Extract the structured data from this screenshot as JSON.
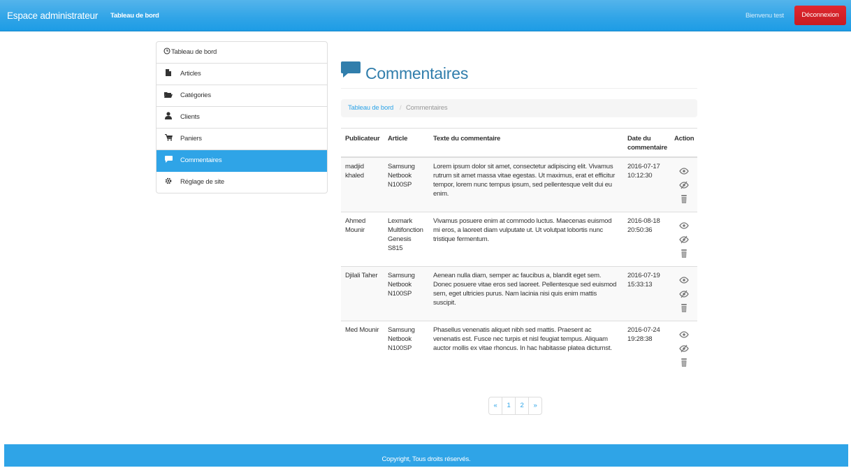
{
  "navbar": {
    "brand": "Espace administrateur",
    "link": "Tableau de bord",
    "welcome": "Bienvenu test",
    "logout": "Déconnexion"
  },
  "sidebar": {
    "items": [
      {
        "label": "Tableau de bord",
        "icon": "clock-icon"
      },
      {
        "label": "Articles",
        "icon": "file-icon"
      },
      {
        "label": "Catégories",
        "icon": "folder-open-icon"
      },
      {
        "label": "Clients",
        "icon": "user-icon"
      },
      {
        "label": "Paniers",
        "icon": "shopping-cart-icon"
      },
      {
        "label": "Commentaires",
        "icon": "comment-icon"
      },
      {
        "label": "Réglage de site",
        "icon": "cog-icon"
      }
    ],
    "active": "Commentaires"
  },
  "page": {
    "title": "Commentaires"
  },
  "breadcrumb": {
    "home": "Tableau de bord",
    "separator": "/",
    "current": "Commentaires"
  },
  "table": {
    "headers": {
      "publisher": "Publicateur",
      "article": "Article",
      "text": "Texte du commentaire",
      "date": "Date du commentaire",
      "action": "Action"
    },
    "rows": [
      {
        "publisher": "madjid khaled",
        "article": "Samsung Netbook N100SP",
        "text": "Lorem ipsum dolor sit amet, consectetur adipiscing elit. Vivamus rutrum sit amet massa vitae egestas. Ut maximus, erat et efficitur tempor, lorem nunc tempus ipsum, sed pellentesque velit dui eu enim.",
        "date": "2016-07-17 10:12:30"
      },
      {
        "publisher": "Ahmed Mounir",
        "article": "Lexmark Multifonction Genesis S815",
        "text": "Vivamus posuere enim at commodo luctus. Maecenas euismod mi eros, a laoreet diam vulputate ut. Ut volutpat lobortis nunc tristique fermentum.",
        "date": "2016-08-18 20:50:36"
      },
      {
        "publisher": "Djilali Taher",
        "article": "Samsung Netbook N100SP",
        "text": "Aenean nulla diam, semper ac faucibus a, blandit eget sem. Donec posuere vitae eros sed laoreet. Pellentesque sed euismod sem, eget ultricies purus. Nam lacinia nisi quis enim mattis suscipit.",
        "date": "2016-07-19 15:33:13"
      },
      {
        "publisher": "Med Mounir",
        "article": "Samsung Netbook N100SP",
        "text": "Phasellus venenatis aliquet nibh sed mattis. Praesent ac venenatis est. Fusce nec turpis et nisl feugiat tempus. Aliquam auctor mollis ex vitae rhoncus. In hac habitasse platea dictumst.",
        "date": "2016-07-24 19:28:38"
      }
    ]
  },
  "pagination": {
    "prev": "«",
    "pages": [
      "1",
      "2"
    ],
    "next": "»"
  },
  "footer": {
    "text": "Copyright, Tous droits réservés."
  },
  "colors": {
    "primary": "#2fa4e7",
    "danger": "#c71c22",
    "heading": "#317eac"
  }
}
